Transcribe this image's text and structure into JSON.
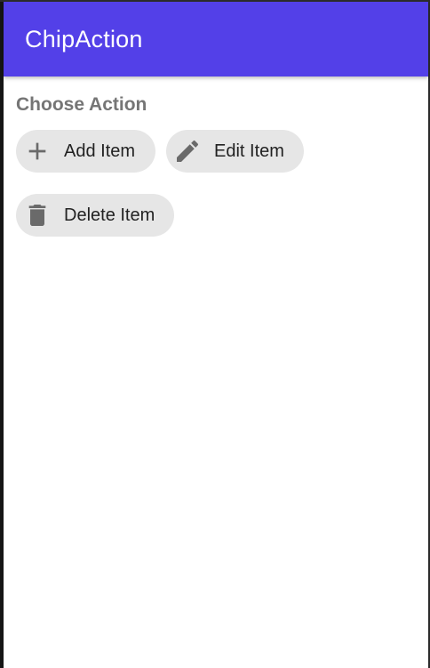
{
  "app_bar": {
    "title": "ChipAction",
    "background_color": "#5340e8",
    "title_color": "#ffffff"
  },
  "content": {
    "section_title": "Choose Action",
    "chips": [
      {
        "label": "Add Item",
        "icon": "plus-icon"
      },
      {
        "label": "Edit Item",
        "icon": "pencil-icon"
      },
      {
        "label": "Delete Item",
        "icon": "trash-icon"
      }
    ],
    "chip_background_color": "#e6e6e6",
    "icon_color": "#6a6a6a"
  }
}
